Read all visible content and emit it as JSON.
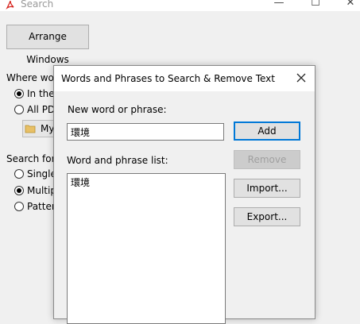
{
  "window": {
    "title": "Search",
    "min_glyph": "—",
    "max_glyph": "☐",
    "close_glyph": "✕"
  },
  "search_panel": {
    "arrange_label": "Arrange Windows",
    "where_label": "Where wou",
    "where_options": [
      "In the",
      "All PD"
    ],
    "where_selected": 0,
    "folder_label": "My",
    "search_for_label": "Search for:",
    "search_for_options": [
      "Single",
      "Multip",
      "Patter"
    ],
    "search_for_selected": 1
  },
  "dialog": {
    "title": "Words and Phrases to Search & Remove Text",
    "new_word_label": "New word or phrase:",
    "new_word_value": "環境",
    "list_label": "Word and phrase list:",
    "list_items": [
      "環境"
    ],
    "buttons": {
      "add": "Add",
      "remove": "Remove",
      "import": "Import...",
      "export": "Export..."
    }
  },
  "colors": {
    "accent": "#0078d7",
    "acrobat_red": "#d6221c"
  }
}
